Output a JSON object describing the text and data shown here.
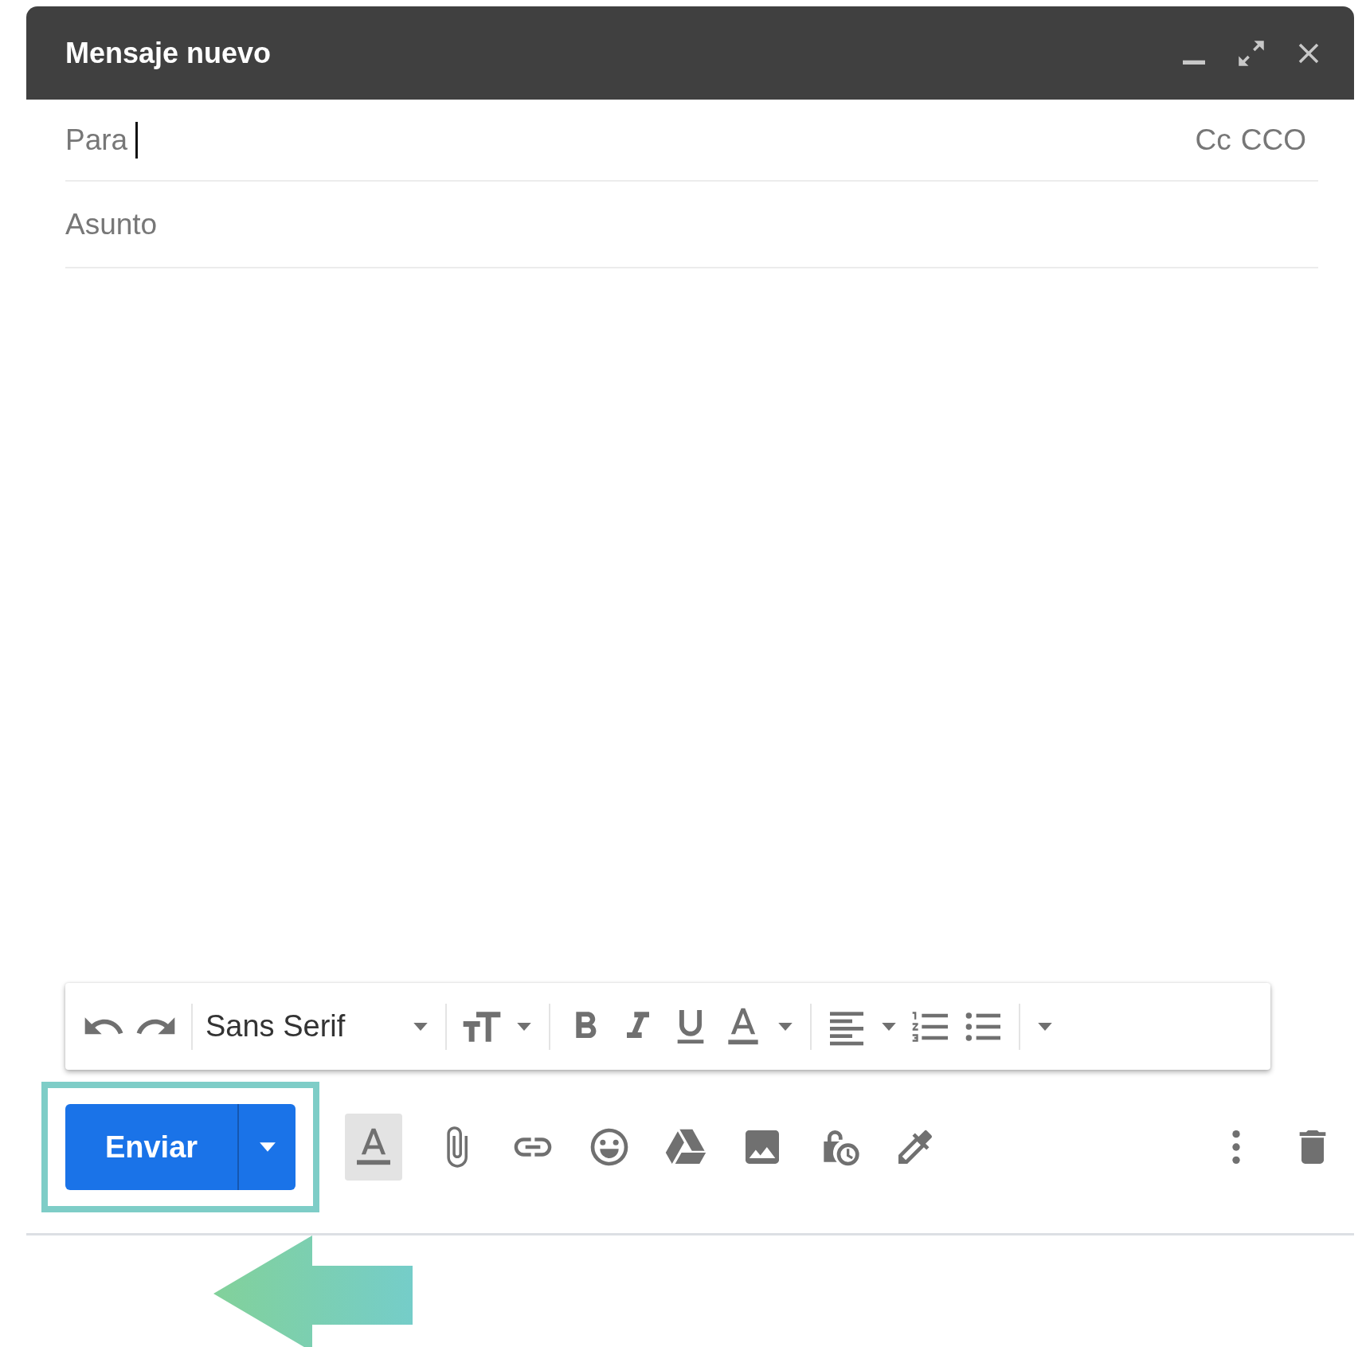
{
  "window": {
    "title": "Mensaje nuevo"
  },
  "recipients": {
    "label": "Para",
    "cc": "Cc",
    "bcc": "CCO"
  },
  "subject": {
    "placeholder": "Asunto"
  },
  "format_toolbar": {
    "font": "Sans Serif"
  },
  "send_button": {
    "label": "Enviar"
  },
  "format_toggle": {
    "selected": true
  }
}
